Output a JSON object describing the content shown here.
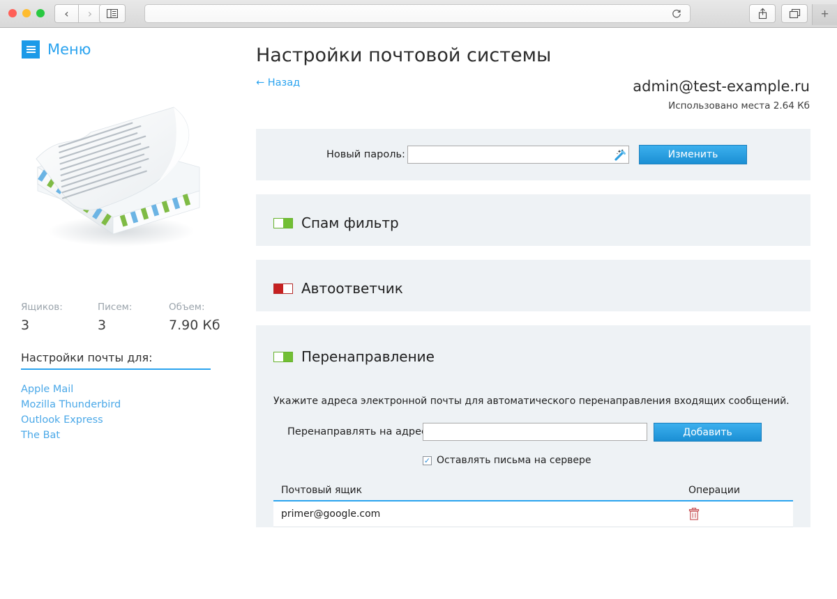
{
  "browser": {
    "url": "",
    "url_placeholder": "",
    "back_icon": "chevron-left-icon",
    "forward_icon": "chevron-right-icon",
    "sidebar_icon": "sidebar-panel-icon",
    "reload_icon": "reload-icon",
    "share_icon": "share-icon",
    "tabs_icon": "show-tabs-icon",
    "new_tab_label": "+"
  },
  "sidebar": {
    "menu_label": "Меню",
    "illustration_name": "stack-of-letters-illustration",
    "stats": [
      {
        "label": "Ящиков:",
        "value": "3"
      },
      {
        "label": "Писем:",
        "value": "3"
      },
      {
        "label": "Объем:",
        "value": "7.90 Кб"
      }
    ],
    "settings_for_title": "Настройки почты для:",
    "clients": [
      "Apple Mail",
      "Mozilla Thunderbird",
      "Outlook Express",
      "The Bat"
    ]
  },
  "main": {
    "title": "Настройки почтовой системы",
    "back_link": "← Назад",
    "account_email": "admin@test-example.ru",
    "account_usage": "Использовано места 2.64 Кб",
    "password": {
      "label": "Новый пароль:",
      "value": "",
      "placeholder": "",
      "generate_icon": "magic-wand-icon",
      "button_label": "Изменить"
    },
    "spam": {
      "title": "Спам фильтр",
      "toggle_state": "on"
    },
    "autoreply": {
      "title": "Автоответчик",
      "toggle_state": "off"
    },
    "forwarding": {
      "title": "Перенаправление",
      "toggle_state": "on",
      "description": "Укажите адреса электронной почты для автоматического перенаправления входящих сообщений.",
      "address_label": "Перенаправлять на адрес:",
      "address_value": "",
      "address_placeholder": "",
      "add_button_label": "Добавить",
      "keep_on_server_label": "Оставлять письма на сервере",
      "keep_on_server_checked": true,
      "table": {
        "columns": [
          "Почтовый ящик",
          "Операции"
        ],
        "rows": [
          {
            "mailbox": "primer@google.com",
            "action_icon": "trash-icon"
          }
        ]
      }
    }
  },
  "colors": {
    "accent_blue": "#2aa3ef",
    "button_blue": "#1b8fd4",
    "panel_bg": "#eef2f5",
    "toggle_on": "#72bf34",
    "toggle_off": "#c62020",
    "trash_red": "#c9565a"
  }
}
